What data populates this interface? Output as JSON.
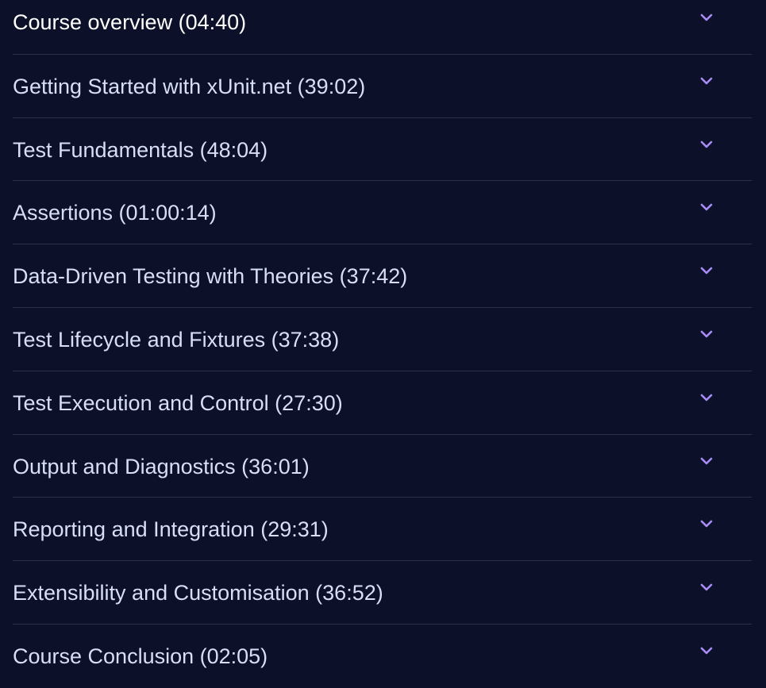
{
  "colors": {
    "background": "#0c1129",
    "divider": "#2c3148",
    "text": "#d9def7",
    "text_active": "#ffffff",
    "chevron": "#a98cf5"
  },
  "accordion": {
    "items": [
      {
        "label": "Course overview (04:40)",
        "icon": "chevron-down-icon"
      },
      {
        "label": "Getting Started with xUnit.net (39:02)",
        "icon": "chevron-down-icon"
      },
      {
        "label": "Test Fundamentals (48:04)",
        "icon": "chevron-down-icon"
      },
      {
        "label": "Assertions (01:00:14)",
        "icon": "chevron-down-icon"
      },
      {
        "label": "Data-Driven Testing with Theories (37:42)",
        "icon": "chevron-down-icon"
      },
      {
        "label": "Test Lifecycle and Fixtures (37:38)",
        "icon": "chevron-down-icon"
      },
      {
        "label": "Test Execution and Control (27:30)",
        "icon": "chevron-down-icon"
      },
      {
        "label": "Output and Diagnostics (36:01)",
        "icon": "chevron-down-icon"
      },
      {
        "label": "Reporting and Integration (29:31)",
        "icon": "chevron-down-icon"
      },
      {
        "label": "Extensibility and Customisation (36:52)",
        "icon": "chevron-down-icon"
      },
      {
        "label": "Course Conclusion (02:05)",
        "icon": "chevron-down-icon"
      }
    ]
  }
}
